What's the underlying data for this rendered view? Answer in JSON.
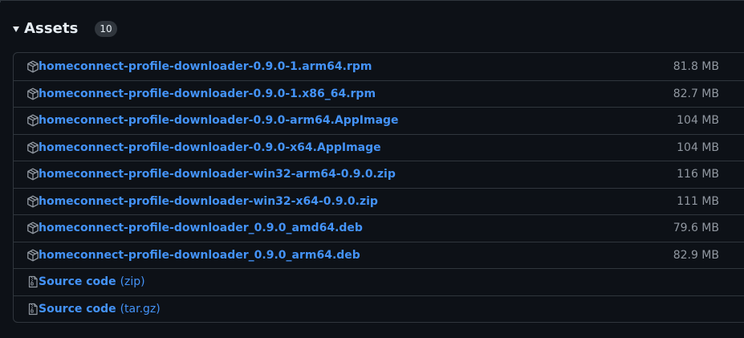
{
  "assets": {
    "title": "Assets",
    "count": "10",
    "items": [
      {
        "name": "homeconnect-profile-downloader-0.9.0-1.arm64.rpm",
        "size": "81.8 MB",
        "icon": "package-icon"
      },
      {
        "name": "homeconnect-profile-downloader-0.9.0-1.x86_64.rpm",
        "size": "82.7 MB",
        "icon": "package-icon"
      },
      {
        "name": "homeconnect-profile-downloader-0.9.0-arm64.AppImage",
        "size": "104 MB",
        "icon": "package-icon"
      },
      {
        "name": "homeconnect-profile-downloader-0.9.0-x64.AppImage",
        "size": "104 MB",
        "icon": "package-icon"
      },
      {
        "name": "homeconnect-profile-downloader-win32-arm64-0.9.0.zip",
        "size": "116 MB",
        "icon": "package-icon"
      },
      {
        "name": "homeconnect-profile-downloader-win32-x64-0.9.0.zip",
        "size": "111 MB",
        "icon": "package-icon"
      },
      {
        "name": "homeconnect-profile-downloader_0.9.0_amd64.deb",
        "size": "79.6 MB",
        "icon": "package-icon"
      },
      {
        "name": "homeconnect-profile-downloader_0.9.0_arm64.deb",
        "size": "82.9 MB",
        "icon": "package-icon"
      }
    ],
    "source": [
      {
        "name": "Source code",
        "suffix": "(zip)",
        "icon": "file-zip-icon"
      },
      {
        "name": "Source code",
        "suffix": "(tar.gz)",
        "icon": "file-zip-icon"
      }
    ]
  },
  "colors": {
    "background": "#0d1117",
    "border": "#30363d",
    "link": "#4493f8",
    "muted": "#9198a1",
    "text": "#e6edf3"
  }
}
